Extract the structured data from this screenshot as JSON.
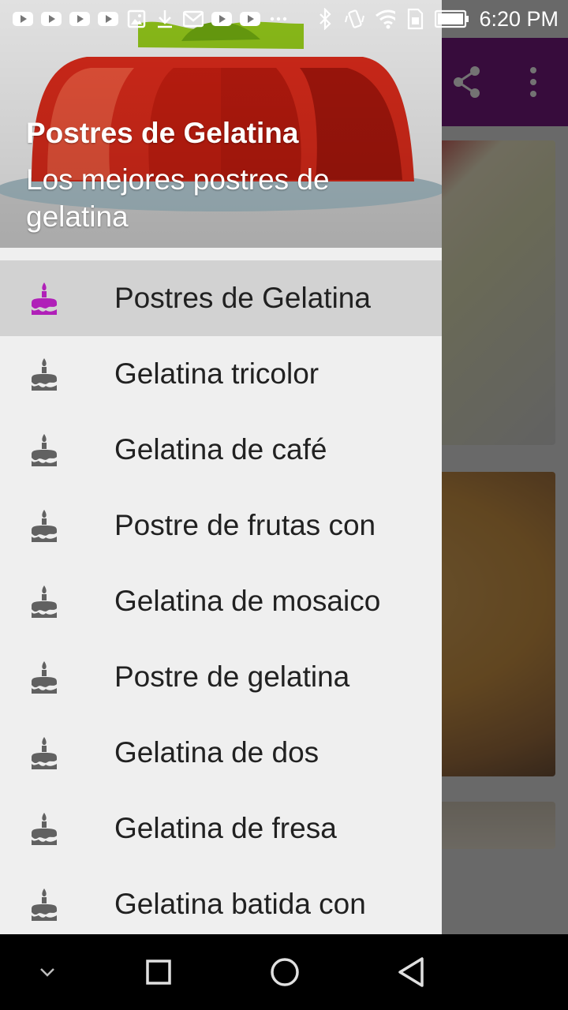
{
  "status_bar": {
    "time": "6:20 PM",
    "notification_icons": [
      "youtube-icon",
      "youtube-icon",
      "youtube-icon",
      "youtube-icon",
      "image-icon",
      "download-icon",
      "gmail-icon",
      "youtube-icon",
      "youtube-icon",
      "more-dots-icon"
    ],
    "system_icons": [
      "bluetooth-icon",
      "vibrate-icon",
      "wifi-icon",
      "sim-icon",
      "battery-icon"
    ]
  },
  "app_bar": {
    "background": "#7b1c86",
    "actions": [
      "share-icon",
      "overflow-menu-icon"
    ]
  },
  "drawer": {
    "header": {
      "title": "Postres de Gelatina",
      "subtitle": "Los mejores postres de gelatina"
    },
    "accent_color": "#b020b8",
    "items": [
      {
        "label": "Postres de Gelatina",
        "icon": "cake-icon",
        "active": true
      },
      {
        "label": "Gelatina tricolor",
        "icon": "cake-icon",
        "active": false
      },
      {
        "label": "Gelatina de café",
        "icon": "cake-icon",
        "active": false
      },
      {
        "label": "Postre de frutas con",
        "icon": "cake-icon",
        "active": false
      },
      {
        "label": "Gelatina de mosaico",
        "icon": "cake-icon",
        "active": false
      },
      {
        "label": "Postre de gelatina",
        "icon": "cake-icon",
        "active": false
      },
      {
        "label": "Gelatina de dos",
        "icon": "cake-icon",
        "active": false
      },
      {
        "label": "Gelatina de fresa",
        "icon": "cake-icon",
        "active": false
      },
      {
        "label": "Gelatina batida con",
        "icon": "cake-icon",
        "active": false
      }
    ]
  },
  "nav_bar": {
    "buttons": [
      "hide-keyboard-icon",
      "recents-icon",
      "home-icon",
      "back-icon"
    ]
  }
}
